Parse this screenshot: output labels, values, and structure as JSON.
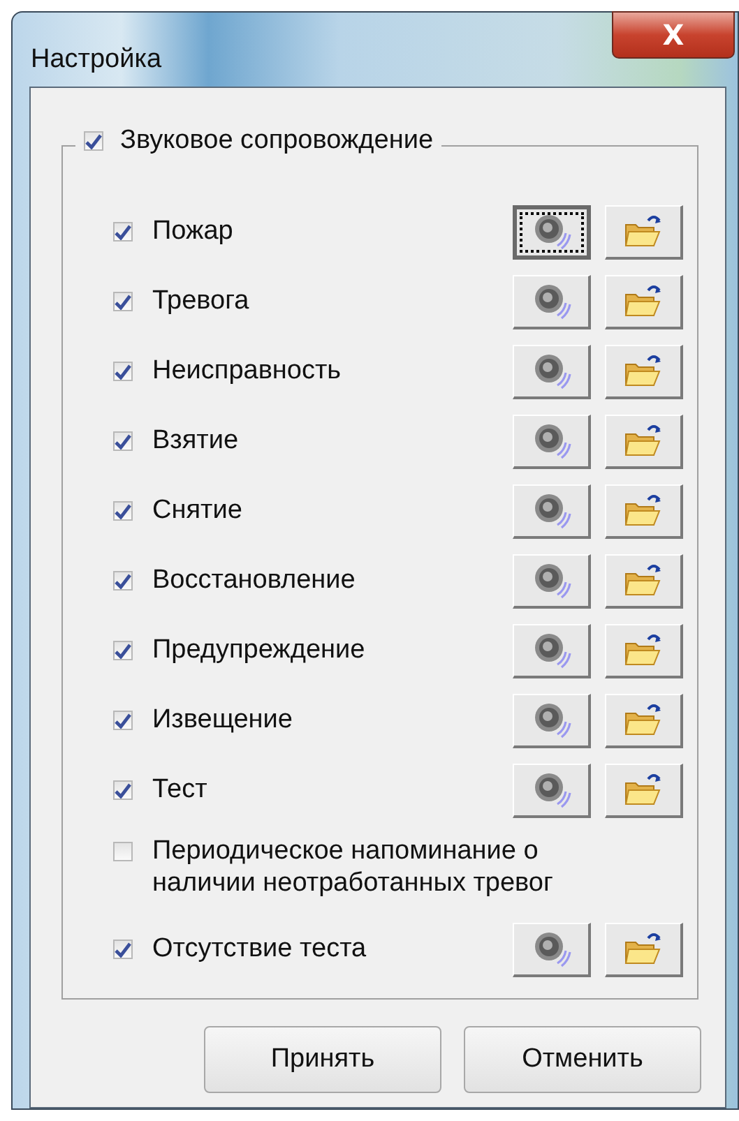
{
  "window": {
    "title": "Настройка",
    "close": "X"
  },
  "group": {
    "label": "Звуковое сопровождение",
    "checked": true
  },
  "rows": [
    {
      "kind": "sound",
      "label": "Пожар",
      "checked": true,
      "focused": true
    },
    {
      "kind": "sound",
      "label": "Тревога",
      "checked": true,
      "focused": false
    },
    {
      "kind": "sound",
      "label": "Неисправность",
      "checked": true,
      "focused": false
    },
    {
      "kind": "sound",
      "label": "Взятие",
      "checked": true,
      "focused": false
    },
    {
      "kind": "sound",
      "label": "Снятие",
      "checked": true,
      "focused": false
    },
    {
      "kind": "sound",
      "label": "Восстановление",
      "checked": true,
      "focused": false
    },
    {
      "kind": "sound",
      "label": "Предупреждение",
      "checked": true,
      "focused": false
    },
    {
      "kind": "sound",
      "label": "Извещение",
      "checked": true,
      "focused": false
    },
    {
      "kind": "sound",
      "label": "Тест",
      "checked": true,
      "focused": false
    },
    {
      "kind": "option",
      "label": "Периодическое напоминание о наличии неотработанных тревог",
      "checked": false
    },
    {
      "kind": "sound",
      "label": "Отсутствие теста",
      "checked": true,
      "focused": false
    }
  ],
  "buttons": [
    "Принять",
    "Отменить"
  ]
}
